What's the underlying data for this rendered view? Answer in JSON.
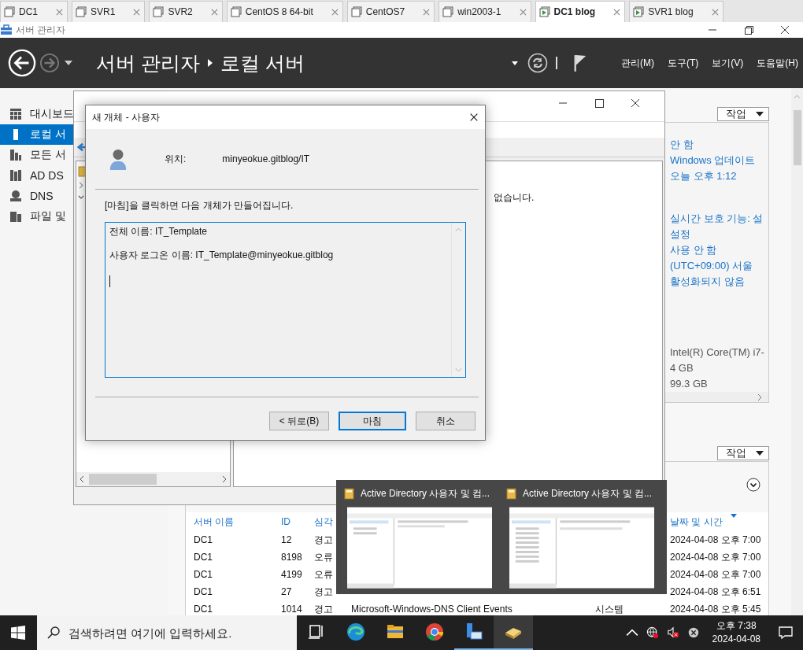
{
  "vm_tabs": [
    {
      "label": "DC1",
      "running": false,
      "selected": false
    },
    {
      "label": "SVR1",
      "running": false,
      "selected": false
    },
    {
      "label": "SVR2",
      "running": false,
      "selected": false
    },
    {
      "label": "CentOS 8 64-bit",
      "running": false,
      "selected": false
    },
    {
      "label": "CentOS7",
      "running": false,
      "selected": false
    },
    {
      "label": "win2003-1",
      "running": false,
      "selected": false
    },
    {
      "label": "DC1 blog",
      "running": true,
      "selected": true
    },
    {
      "label": "SVR1 blog",
      "running": true,
      "selected": false
    }
  ],
  "window": {
    "title": "서버 관리자"
  },
  "header": {
    "breadcrumb": [
      "서버 관리자",
      "로컬 서버"
    ],
    "menus": [
      "관리(M)",
      "도구(T)",
      "보기(V)",
      "도움말(H)"
    ]
  },
  "sidebar": {
    "items": [
      {
        "label": "대시보드",
        "selected": false
      },
      {
        "label": "로컬 서",
        "selected": true
      },
      {
        "label": "모든 서",
        "selected": false
      },
      {
        "label": "AD DS",
        "selected": false
      },
      {
        "label": "DNS",
        "selected": false
      },
      {
        "label": "파일 및",
        "selected": false
      }
    ]
  },
  "properties": {
    "tasks_button": "작업",
    "groups": [
      {
        "kind": "link",
        "values": [
          "안 함",
          "Windows 업데이트",
          "오늘 오후 1:12"
        ]
      },
      {
        "kind": "link",
        "values": [
          "실시간 보호 기능: 설",
          "설정",
          "사용 안 함",
          "(UTC+09:00) 서울",
          "활성화되지 않음"
        ]
      },
      {
        "kind": "plain",
        "values": [
          "Intel(R) Core(TM) i7-",
          "4 GB",
          "99.3 GB"
        ]
      }
    ]
  },
  "events": {
    "tasks_button": "작업",
    "columns": [
      {
        "label": "서버 이름",
        "sorted": false
      },
      {
        "label": "ID",
        "sorted": false
      },
      {
        "label": "심각",
        "sorted": false
      },
      {
        "label": "날짜 및 시간",
        "sorted": true
      }
    ],
    "rows": [
      {
        "server": "DC1",
        "id": "12",
        "severity": "경고",
        "date": "2024-04-08 오후 7:00"
      },
      {
        "server": "DC1",
        "id": "8198",
        "severity": "오류",
        "date": "2024-04-08 오후 7:00"
      },
      {
        "server": "DC1",
        "id": "4199",
        "severity": "오류",
        "date": "2024-04-08 오후 7:00"
      },
      {
        "server": "DC1",
        "id": "27",
        "severity": "경고",
        "date": "2024-04-08 오후 6:51"
      },
      {
        "server": "DC1",
        "id": "1014",
        "severity": "경고",
        "source": "Microsoft-Windows-DNS Client Events",
        "log": "시스템",
        "date": "2024-04-08 오후 5:45"
      }
    ]
  },
  "ad_window": {
    "message": "없습니다."
  },
  "dialog": {
    "title": "새 개체 - 사용자",
    "location_label": "위치:",
    "location": "minyeokue.gitblog/IT",
    "intro": "[마침]을 클릭하면 다음 개체가 만들어집니다.",
    "summary": [
      "전체 이름: IT_Template",
      "사용자 로그온 이름: IT_Template@minyeokue.gitblog"
    ],
    "buttons": [
      {
        "label": "< 뒤로(B)",
        "default": false
      },
      {
        "label": "마침",
        "default": true
      },
      {
        "label": "취소",
        "default": false
      }
    ]
  },
  "previews": [
    {
      "title": "Active Directory 사용자 및 컴..."
    },
    {
      "title": "Active Directory 사용자 및 컴..."
    }
  ],
  "taskbar": {
    "search": {
      "placeholder": "검색하려면 여기에 입력하세요."
    },
    "apps": [
      {
        "kind": "taskview",
        "running": false,
        "selected": false
      },
      {
        "kind": "edge",
        "running": false,
        "selected": false
      },
      {
        "kind": "explorer",
        "running": false,
        "selected": false
      },
      {
        "kind": "chrome",
        "running": false,
        "selected": false
      },
      {
        "kind": "servermanager",
        "running": true,
        "selected": false
      },
      {
        "kind": "ad",
        "running": true,
        "selected": true
      }
    ],
    "clock": {
      "time": "오후 7:38",
      "date": "2024-04-08"
    }
  }
}
